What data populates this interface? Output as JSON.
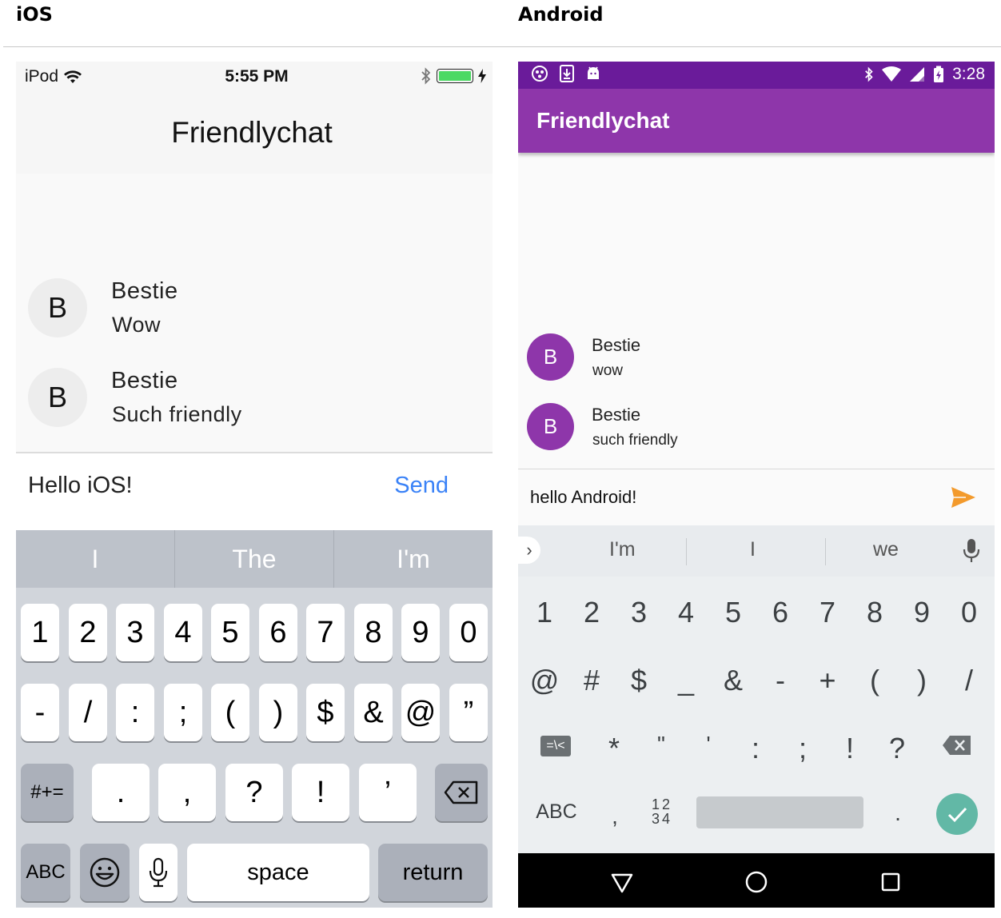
{
  "headings": {
    "ios": "iOS",
    "android": "Android"
  },
  "ios": {
    "status": {
      "carrier": "iPod",
      "time": "5:55 PM"
    },
    "nav_title": "Friendlychat",
    "messages": [
      {
        "avatar": "B",
        "name": "Bestie",
        "text": "Wow"
      },
      {
        "avatar": "B",
        "name": "Bestie",
        "text": "Such friendly"
      }
    ],
    "compose": {
      "value": "Hello iOS!",
      "send_label": "Send"
    },
    "suggestions": [
      "I",
      "The",
      "I'm"
    ],
    "keys_row1": [
      "1",
      "2",
      "3",
      "4",
      "5",
      "6",
      "7",
      "8",
      "9",
      "0"
    ],
    "keys_row2": [
      "-",
      "/",
      ":",
      ";",
      "(",
      ")",
      "$",
      "&",
      "@",
      "”"
    ],
    "keys_row3": {
      "shift": "#+=",
      "keys": [
        ".",
        ",",
        "?",
        "!",
        "’"
      ]
    },
    "keys_row4": {
      "abc": "ABC",
      "space": "space",
      "return": "return"
    },
    "colors": {
      "accent": "#3a82f7"
    }
  },
  "android": {
    "status": {
      "time": "3:28"
    },
    "app_title": "Friendlychat",
    "messages": [
      {
        "avatar": "B",
        "name": "Bestie",
        "text": "wow"
      },
      {
        "avatar": "B",
        "name": "Bestie",
        "text": "such friendly"
      }
    ],
    "compose": {
      "value": "hello Android!"
    },
    "suggestions": [
      "I'm",
      "I",
      "we"
    ],
    "keys_row1": [
      "1",
      "2",
      "3",
      "4",
      "5",
      "6",
      "7",
      "8",
      "9",
      "0"
    ],
    "keys_row2": [
      "@",
      "#",
      "$",
      "_",
      "&",
      "-",
      "+",
      "(",
      ")",
      "/"
    ],
    "keys_row3": {
      "mode": "=\\<",
      "keys": [
        "*",
        "\"",
        "'",
        ":",
        ";",
        "!",
        "?"
      ]
    },
    "keys_row4": {
      "abc": "ABC",
      "comma": ",",
      "numpad_top": "12",
      "numpad_bottom": "34",
      "period": "."
    },
    "colors": {
      "primary": "#8e36aa",
      "status": "#6a1b9a",
      "send": "#f39a2c",
      "confirm": "#62b8a6"
    }
  }
}
